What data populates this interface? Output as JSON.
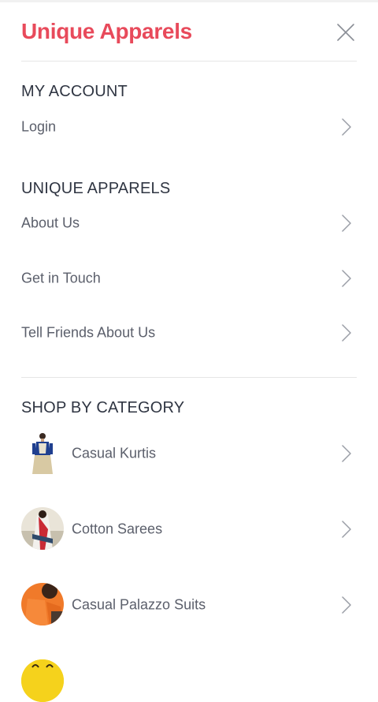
{
  "header": {
    "brand": "Unique Apparels",
    "close_icon": "close-icon"
  },
  "colors": {
    "brand": "#e84a5b",
    "text": "#2f3542",
    "muted": "#5b5f6b",
    "divider": "#e6e6e6"
  },
  "my_account": {
    "title": "MY ACCOUNT",
    "items": [
      {
        "label": "Login",
        "icon": "chevron-right-icon"
      }
    ]
  },
  "unique_apparels": {
    "title": "UNIQUE APPARELS",
    "items": [
      {
        "label": "About Us",
        "icon": "chevron-right-icon"
      },
      {
        "label": "Get in Touch",
        "icon": "chevron-right-icon"
      },
      {
        "label": "Tell Friends About Us",
        "icon": "chevron-right-icon"
      }
    ]
  },
  "shop_by_category": {
    "title": "SHOP BY CATEGORY",
    "items": [
      {
        "label": "Casual Kurtis",
        "icon": "chevron-right-icon"
      },
      {
        "label": "Cotton Sarees",
        "icon": "chevron-right-icon"
      },
      {
        "label": "Casual Palazzo Suits",
        "icon": "chevron-right-icon"
      }
    ]
  }
}
